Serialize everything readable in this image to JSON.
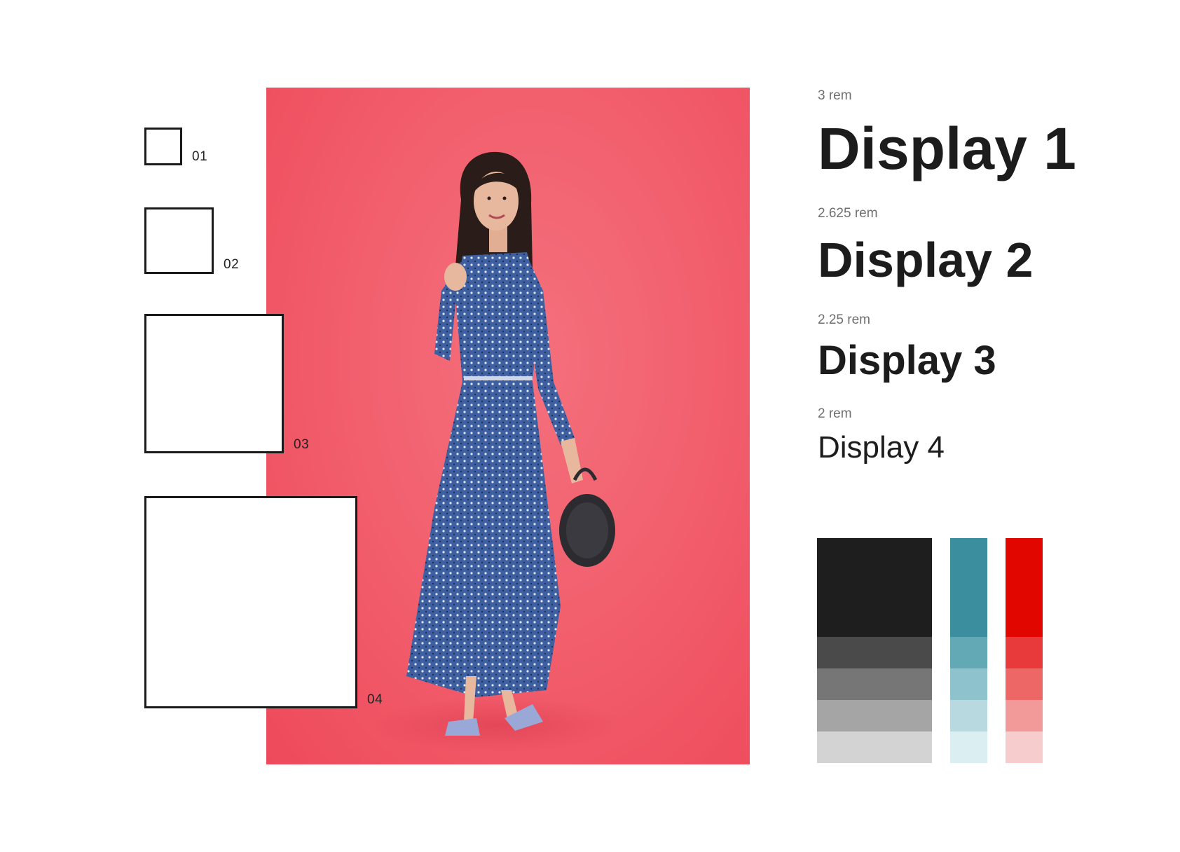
{
  "size_boxes": [
    {
      "label": "01"
    },
    {
      "label": "02"
    },
    {
      "label": "03"
    },
    {
      "label": "04"
    }
  ],
  "type_scale": [
    {
      "size": "3 rem",
      "name": "Display 1"
    },
    {
      "size": "2.625 rem",
      "name": "Display 2"
    },
    {
      "size": "2.25 rem",
      "name": "Display 3"
    },
    {
      "size": "2 rem",
      "name": "Display 4"
    }
  ],
  "palette": {
    "neutral": [
      "#1e1e1e",
      "#4a4a4a",
      "#767676",
      "#a5a5a5",
      "#d3d3d3"
    ],
    "teal": [
      "#3a8e9e",
      "#62a8b5",
      "#8ec2cc",
      "#b8d9df",
      "#dbeef1"
    ],
    "red": [
      "#e10600",
      "#e83a3a",
      "#ee6767",
      "#f29a9a",
      "#f7cccc"
    ]
  },
  "photo": {
    "background": "#f2606e",
    "dress_color": "#3e5fa0",
    "hair_color": "#2a1c18",
    "skin_color": "#e8b89e",
    "bag_color": "#2c2c30",
    "shoe_color": "#9aa8d8"
  }
}
